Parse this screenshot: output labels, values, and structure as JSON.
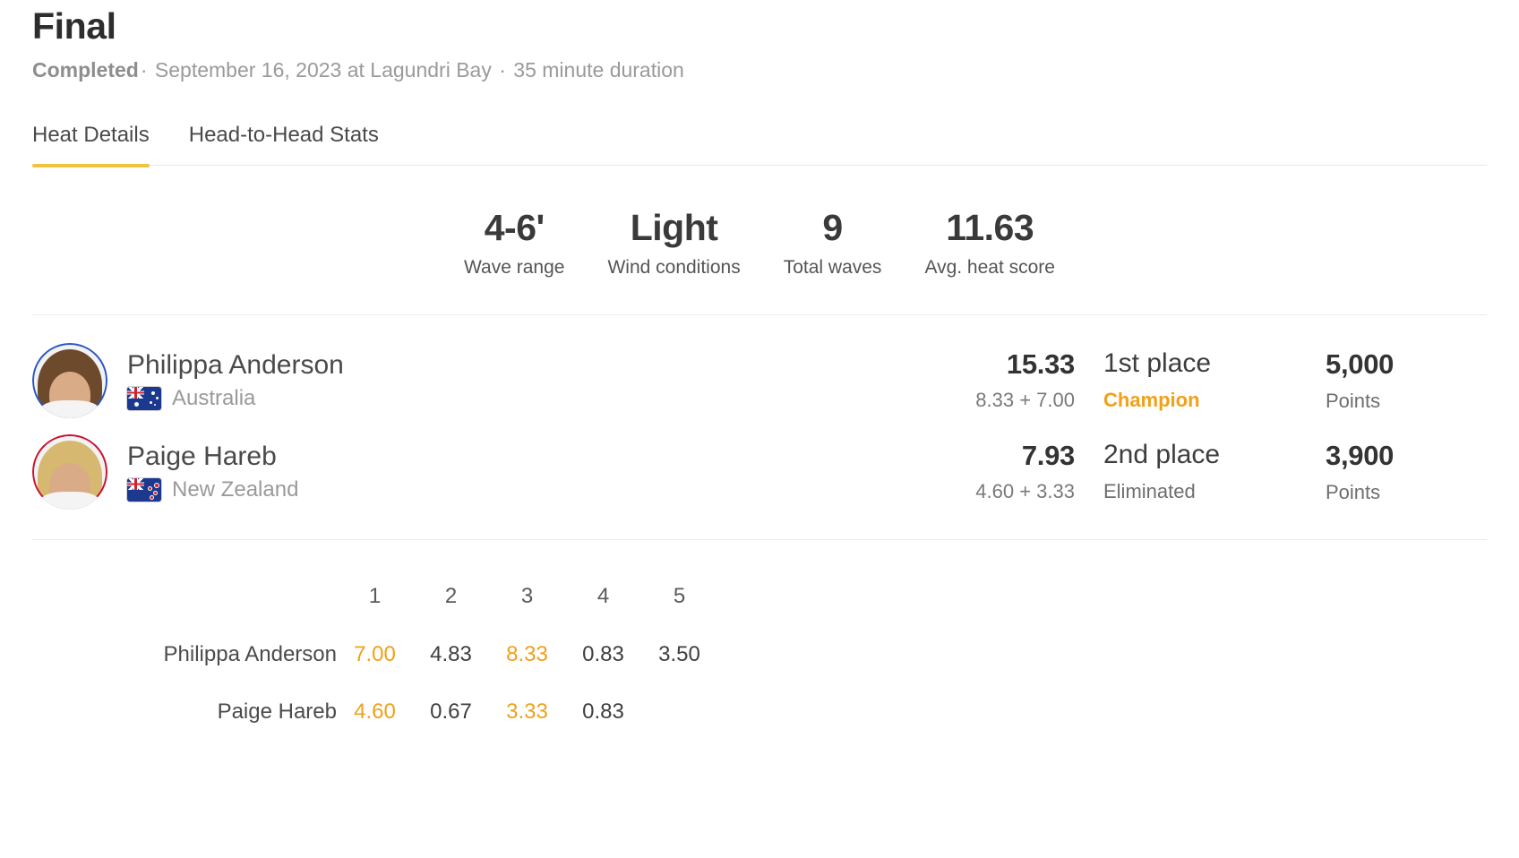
{
  "header": {
    "title": "Final",
    "status": "Completed",
    "separator": "·",
    "date_location": "September 16, 2023 at Lagundri Bay",
    "duration": "35 minute duration"
  },
  "tabs": [
    {
      "label": "Heat Details",
      "active": true
    },
    {
      "label": "Head-to-Head Stats",
      "active": false
    }
  ],
  "conditions": [
    {
      "value": "4-6'",
      "label": "Wave range"
    },
    {
      "value": "Light",
      "label": "Wind conditions"
    },
    {
      "value": "9",
      "label": "Total waves"
    },
    {
      "value": "11.63",
      "label": "Avg. heat score"
    }
  ],
  "athletes": [
    {
      "name": "Philippa Anderson",
      "country": "Australia",
      "flag": "au",
      "ring_color": "#2b55c4",
      "total_score": "15.33",
      "score_breakdown": "8.33 + 7.00",
      "place": "1st place",
      "status": "Champion",
      "status_highlight": true,
      "points": "5,000",
      "points_label": "Points"
    },
    {
      "name": "Paige Hareb",
      "country": "New Zealand",
      "flag": "nz",
      "ring_color": "#c8102e",
      "total_score": "7.93",
      "score_breakdown": "4.60 + 3.33",
      "place": "2nd place",
      "status": "Eliminated",
      "status_highlight": false,
      "points": "3,900",
      "points_label": "Points"
    }
  ],
  "wave_table": {
    "columns": [
      "1",
      "2",
      "3",
      "4",
      "5"
    ],
    "rows": [
      {
        "name": "Philippa Anderson",
        "scores": [
          "7.00",
          "4.83",
          "8.33",
          "0.83",
          "3.50"
        ],
        "counting": [
          true,
          false,
          true,
          false,
          false
        ]
      },
      {
        "name": "Paige Hareb",
        "scores": [
          "4.60",
          "0.67",
          "3.33",
          "0.83",
          ""
        ],
        "counting": [
          true,
          false,
          true,
          false,
          false
        ]
      }
    ]
  },
  "colors": {
    "accent": "#efc53f",
    "highlight": "#f0a019",
    "text": "#3b3b3b",
    "muted": "#9a9a9a"
  }
}
